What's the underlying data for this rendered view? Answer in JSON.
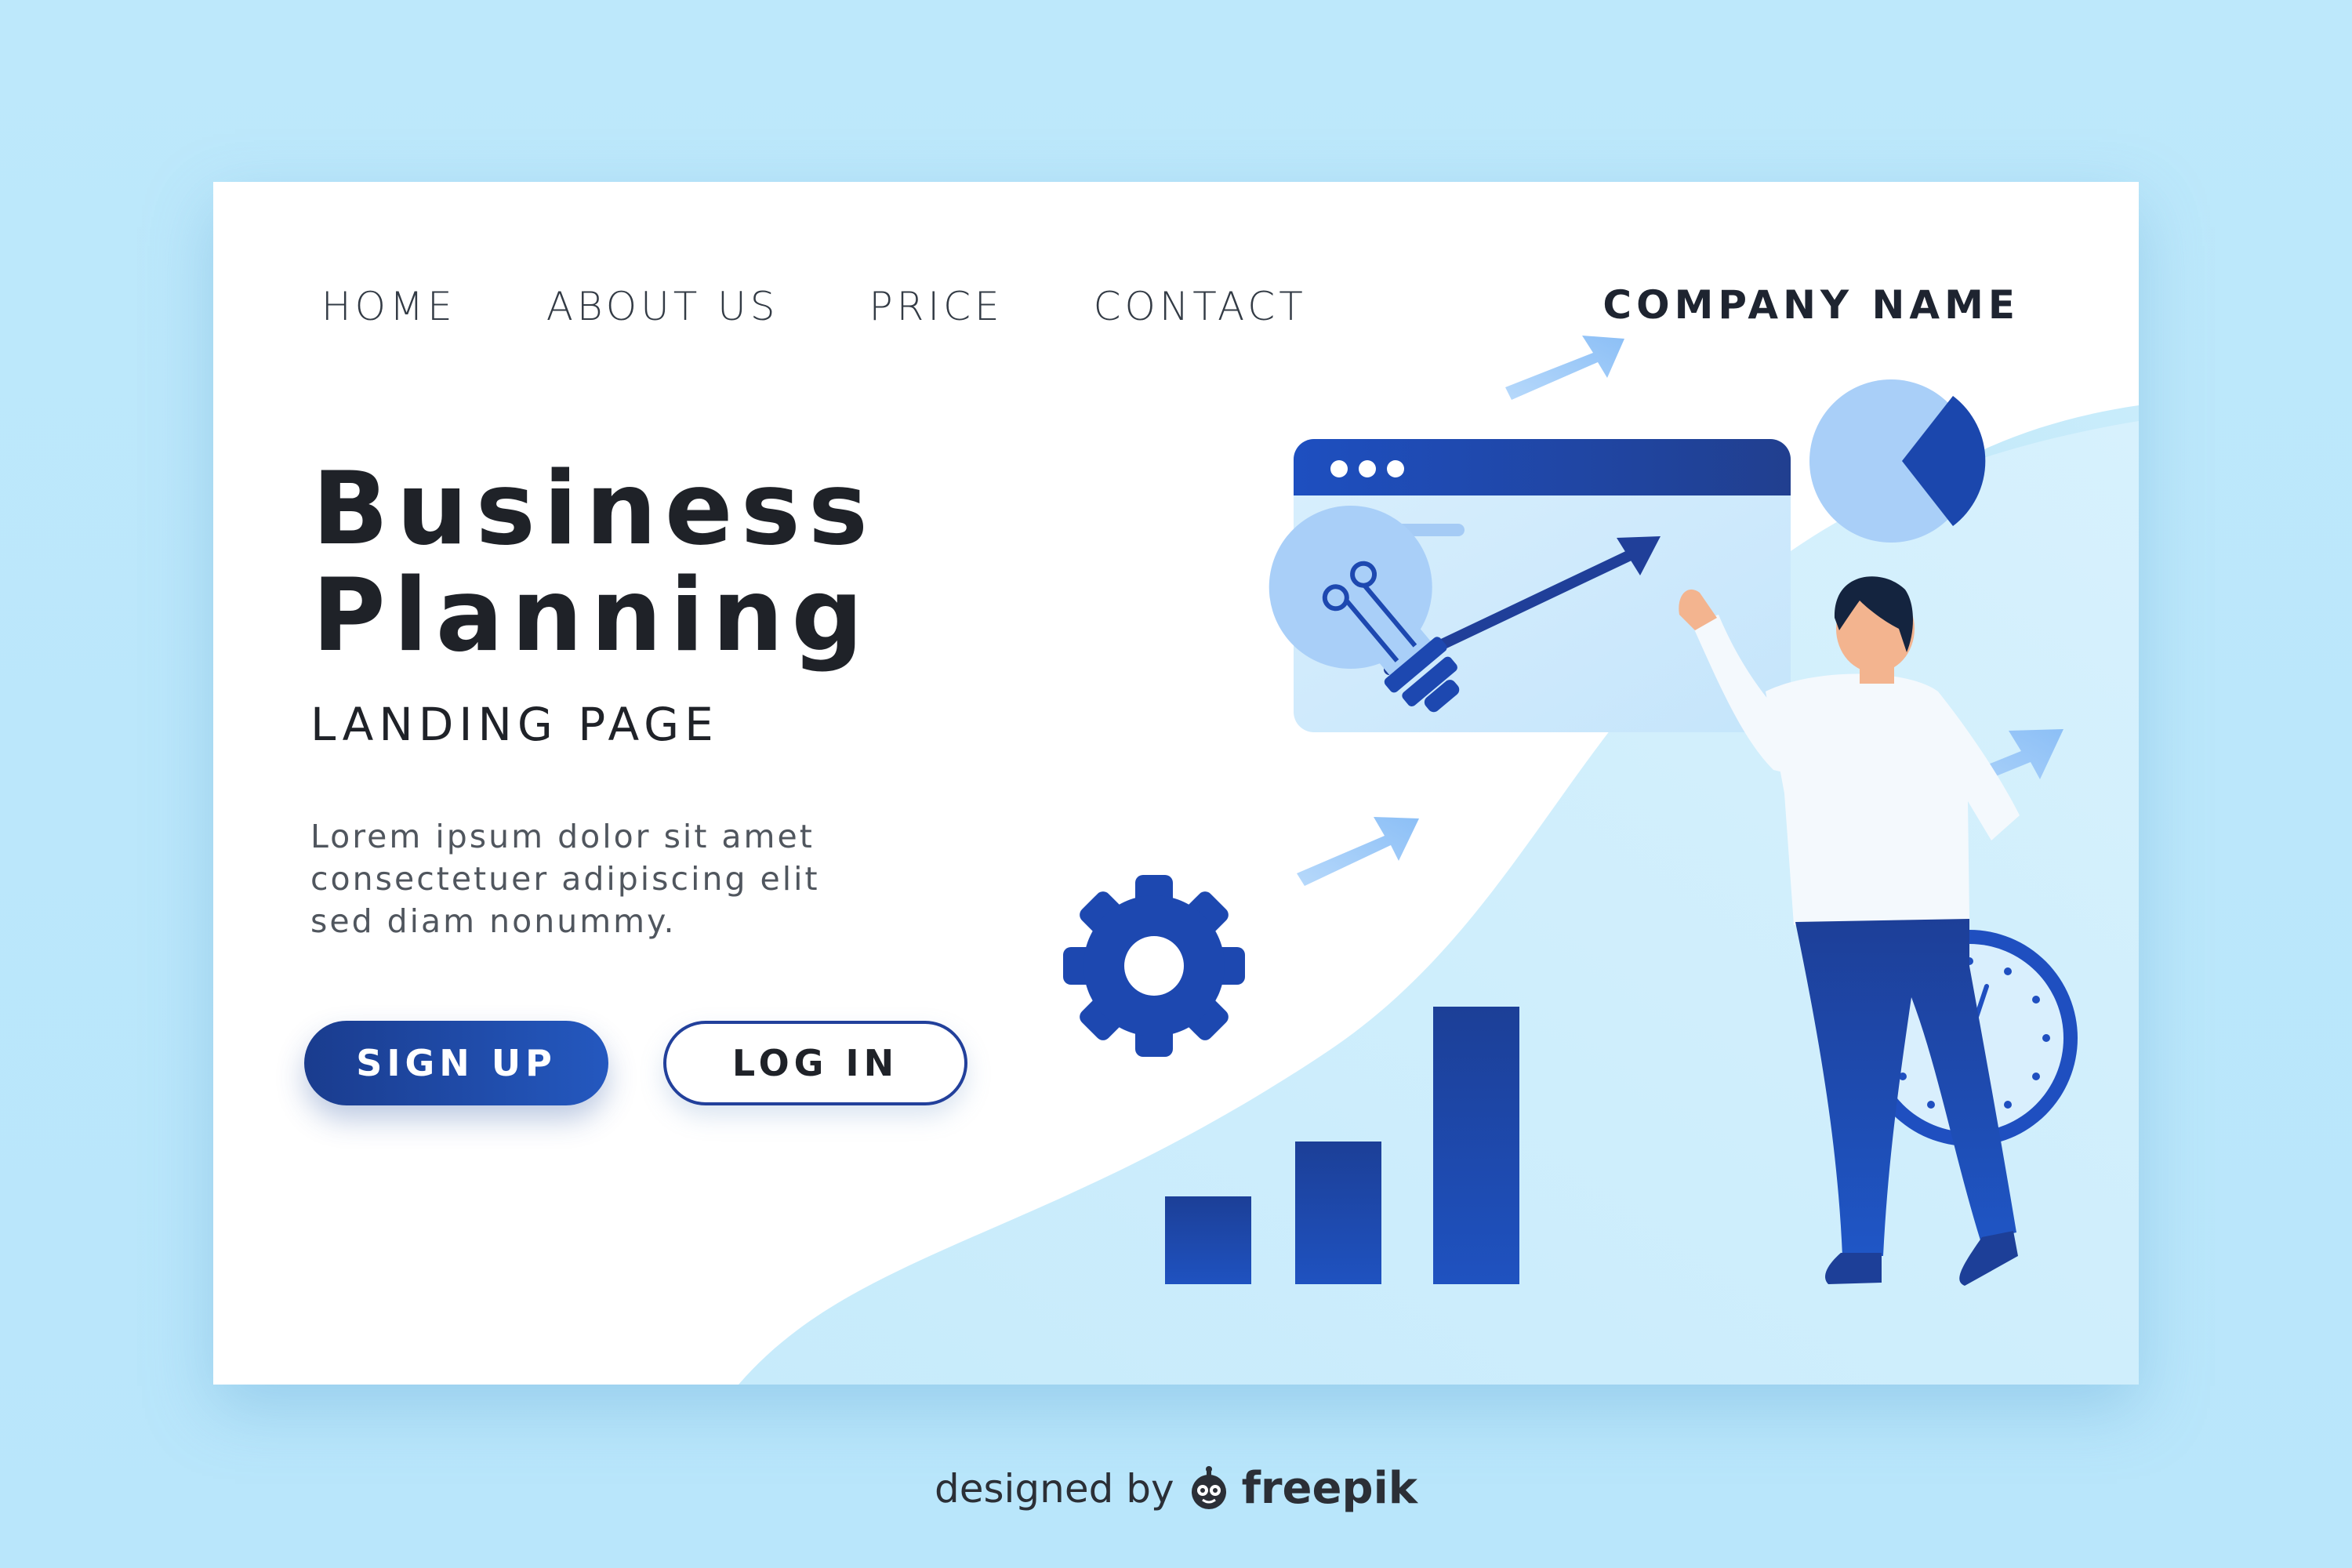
{
  "nav": {
    "items": [
      "HOME",
      "ABOUT US",
      "PRICE",
      "CONTACT"
    ],
    "company": "COMPANY NAME"
  },
  "hero": {
    "title_line1": "Business",
    "title_line2": "Planning",
    "subtitle": "LANDING PAGE",
    "desc_line1": "Lorem ipsum dolor sit amet",
    "desc_line2": "consectetuer adipiscing elit",
    "desc_line3": "sed diam nonummy."
  },
  "buttons": {
    "signup": "SIGN UP",
    "login": "LOG IN"
  },
  "footer": {
    "designed_by": "designed by",
    "brand": "freepik"
  },
  "colors": {
    "background": "#bde8fb",
    "card": "#ffffff",
    "primary_blue": "#1e4bb0",
    "dark_blue": "#1a3c8e",
    "light_blue": "#a9cff8"
  },
  "icons": [
    "lightbulb-icon",
    "gear-icon",
    "browser-window-icon",
    "pie-chart-icon",
    "clock-icon",
    "arrow-icon",
    "bar-chart-icon",
    "person-illustration",
    "freepik-mascot-icon"
  ]
}
